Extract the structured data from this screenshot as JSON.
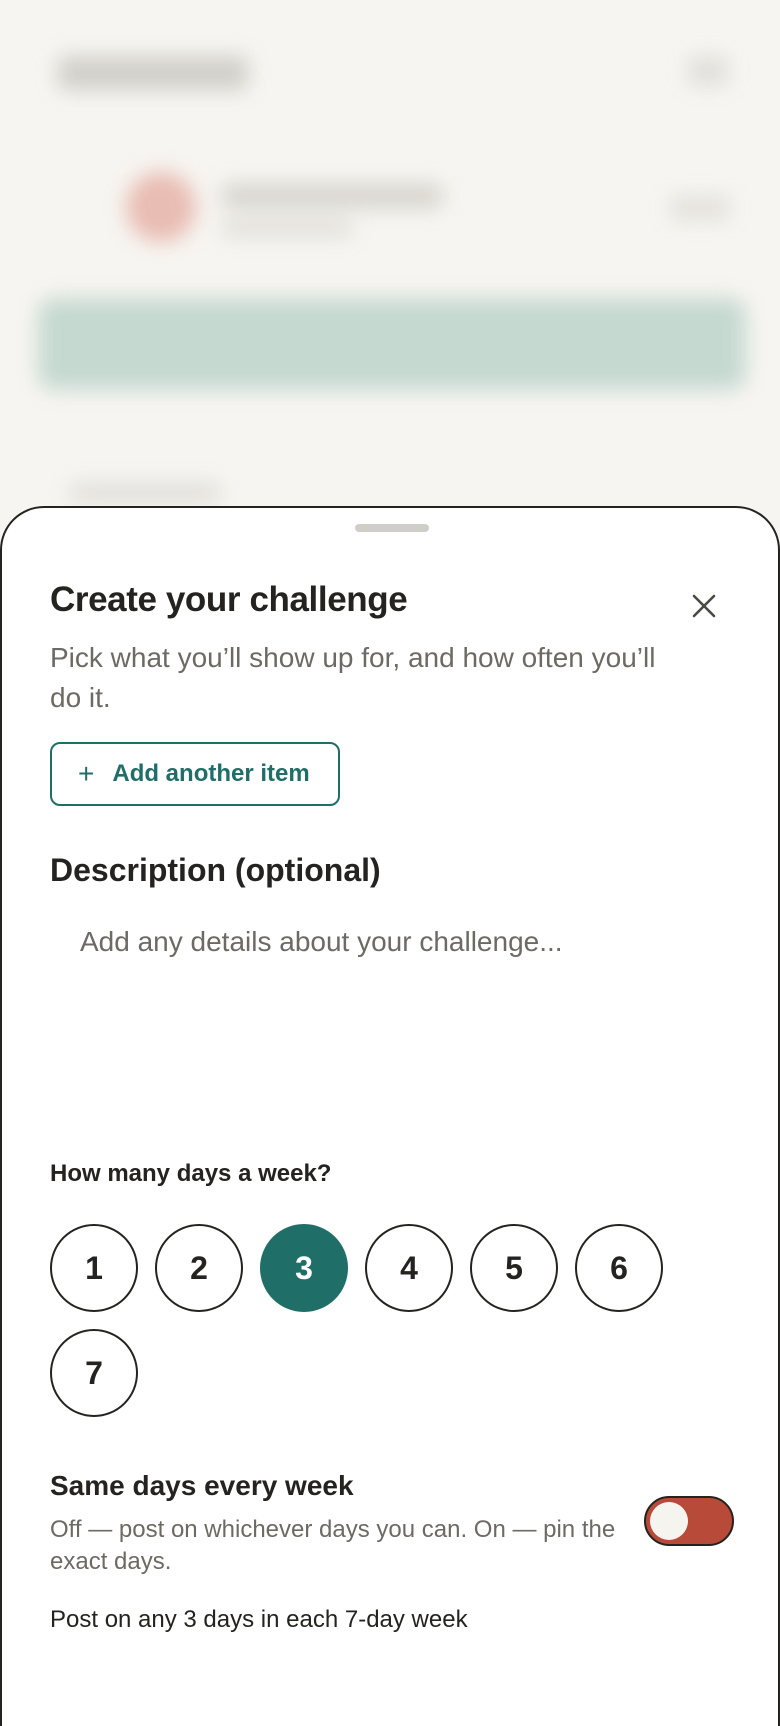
{
  "sheet": {
    "title": "Create your challenge",
    "subtitle": "Pick what you’ll show up for, and how often you’ll do it.",
    "close_icon": "close-icon",
    "add_item": {
      "icon": "plus-icon",
      "label": "Add another item"
    },
    "description": {
      "label": "Description (optional)",
      "value": "",
      "placeholder": "Add any details about your challenge..."
    },
    "days": {
      "label": "How many days a week?",
      "options": [
        "1",
        "2",
        "3",
        "4",
        "5",
        "6",
        "7"
      ],
      "selected": "3"
    },
    "same_days": {
      "title": "Same days every week",
      "description": "Off — post on whichever days you can. On — pin the exact days.",
      "toggle_on": false
    },
    "summary": "Post on any 3 days in each 7-day week"
  },
  "colors": {
    "accent": "#1f6f68",
    "toggle_off": "#b84a3a",
    "text": "#24231f",
    "muted": "#6c6a62"
  }
}
